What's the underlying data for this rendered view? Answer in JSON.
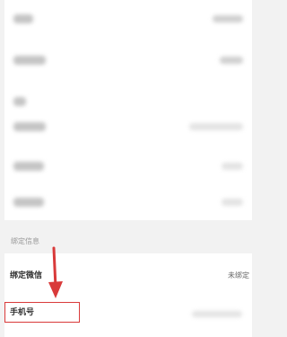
{
  "section": {
    "binding_title": "绑定信息"
  },
  "bindings": {
    "wechat": {
      "label": "绑定微信",
      "value": "未绑定"
    },
    "phone": {
      "label": "手机号"
    }
  },
  "colors": {
    "highlight": "#d93a3a",
    "background": "#f2f2f2",
    "card": "#ffffff"
  }
}
